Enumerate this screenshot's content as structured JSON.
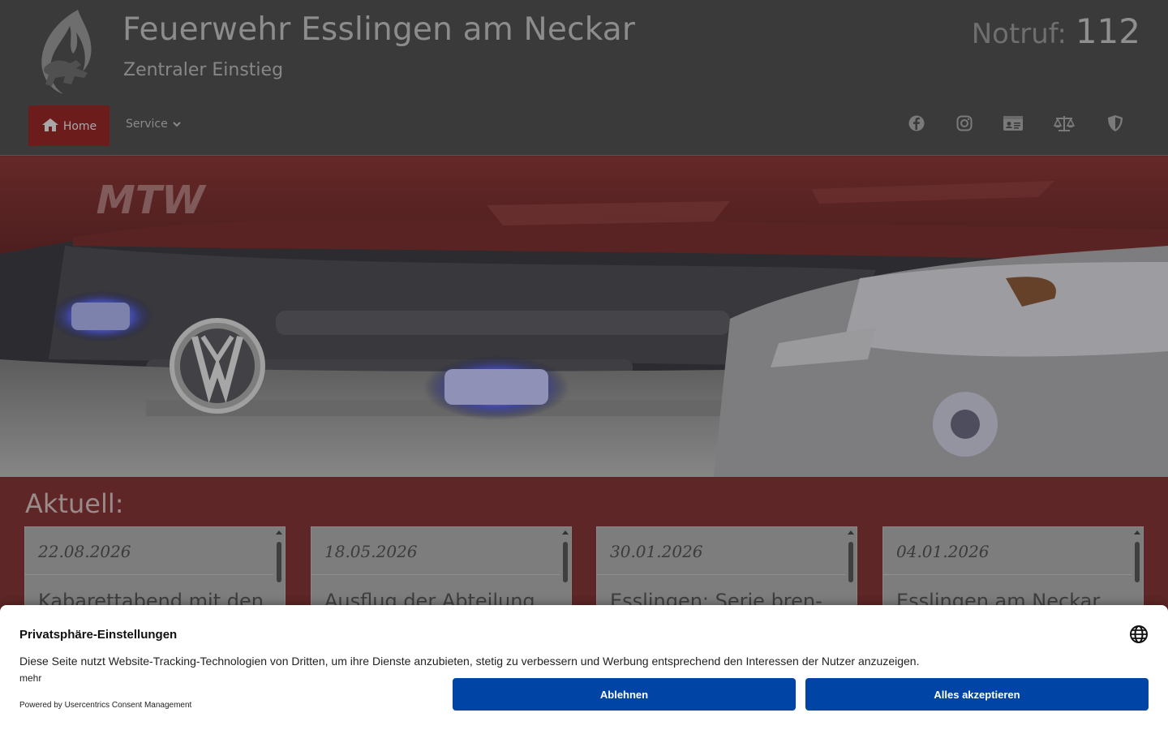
{
  "header": {
    "title": "Feuerwehr Esslingen am Neckar",
    "subtitle": "Zentraler Einstieg",
    "emergency_label": "Notruf:",
    "emergency_number": "112"
  },
  "nav": {
    "home_label": "Home",
    "service_label": "Service"
  },
  "social_icons": [
    "facebook-icon",
    "instagram-icon",
    "id-card-icon",
    "scale-icon",
    "shield-icon"
  ],
  "aktuell": {
    "title": "Aktuell:",
    "cards": [
      {
        "date": "22.08.2026",
        "title": "Kabarettabend mit den"
      },
      {
        "date": "18.05.2026",
        "title": "Ausflug der Abteilung"
      },
      {
        "date": "30.01.2026",
        "title": "Esslingen: Serie bren-"
      },
      {
        "date": "04.01.2026",
        "title": "Esslingen am Neckar"
      }
    ]
  },
  "consent": {
    "title": "Privatsphäre-Einstellungen",
    "text": "Diese Seite nutzt Website-Tracking-Technologien von Dritten, um ihre Dienste anzubieten, stetig zu verbessern und Werbung entsprechend den Interessen der Nutzer anzuzeigen.",
    "more": "mehr",
    "powered": "Powered by Usercentrics Consent Management",
    "decline": "Ablehnen",
    "accept": "Alles akzeptieren"
  },
  "colors": {
    "header_bg": "#3a3a3a",
    "nav_active": "#6d1c1c",
    "page_bg": "#5e2626",
    "button_blue": "#0045a5"
  }
}
